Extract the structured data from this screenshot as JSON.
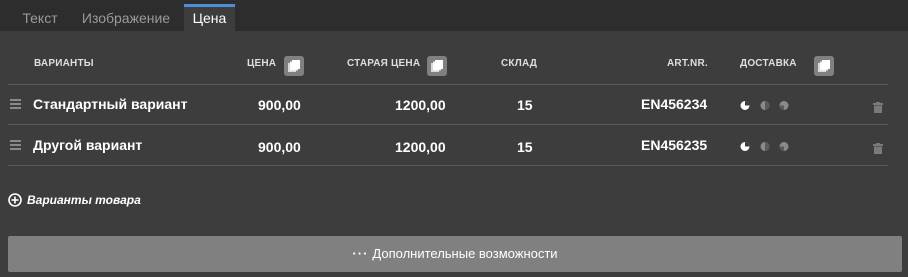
{
  "tabs": [
    {
      "label": "Текст",
      "active": false
    },
    {
      "label": "Изображение",
      "active": false
    },
    {
      "label": "Цена",
      "active": true
    }
  ],
  "colors": {
    "accent": "#4a8fd8",
    "background": "#3d3d3d",
    "tabbar": "#2d2d2d",
    "button": "#808080"
  },
  "table": {
    "headers": {
      "variants": "ВАРИАНТЫ",
      "price": "ЦЕНА",
      "old_price": "СТАРАЯ ЦЕНА",
      "stock": "СКЛАД",
      "art_nr": "ART.NR.",
      "delivery": "ДОСТАВКА"
    },
    "rows": [
      {
        "name": "Стандартный вариант",
        "price": "900,00",
        "old_price": "1200,00",
        "stock": "15",
        "art_nr": "EN456234"
      },
      {
        "name": "Другой вариант",
        "price": "900,00",
        "old_price": "1200,00",
        "stock": "15",
        "art_nr": "EN456235"
      }
    ]
  },
  "add_variants_label": "Варианты товара",
  "more_options": {
    "dots": "···",
    "label": "Дополнительные возможности"
  }
}
